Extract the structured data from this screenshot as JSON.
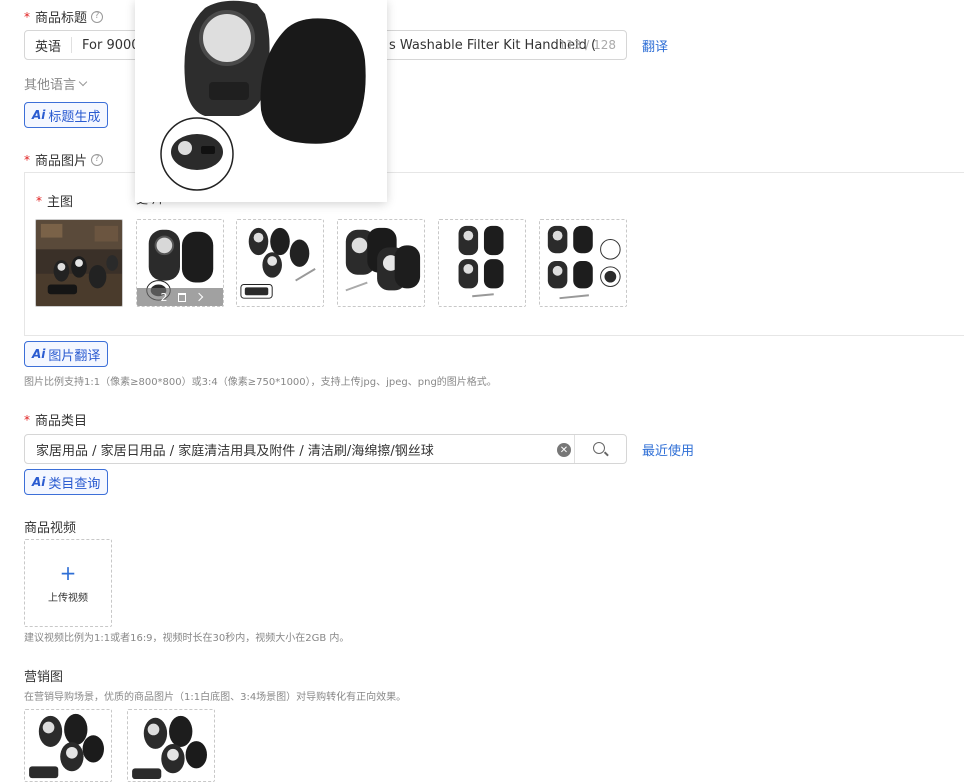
{
  "title_field": {
    "label": "商品标题",
    "language": "英语",
    "value_left": "For  9000 S",
    "value_right": "s Washable Filter Kit Handheld (",
    "counter": "113 / 128",
    "translate_link": "翻译"
  },
  "other_languages": "其他语言",
  "ai_title_button": "标题生成",
  "images_field": {
    "label": "商品图片",
    "main_label": "主图",
    "overlap_text": "更‧片",
    "hover_controls": "2",
    "thumbnails": [
      "workbench-photo",
      "filter-pair",
      "filter-kit",
      "filter-pair-brush",
      "four-filters",
      "filter-set"
    ]
  },
  "ai_image_translate_button": "图片翻译",
  "images_hint": "图片比例支持1:1（像素≥800*800）或3:4（像素≥750*1000），支持上传jpg、jpeg、png的图片格式。",
  "category_field": {
    "label": "商品类目",
    "value": "家居用品 / 家居日用品 / 家庭清洁用具及附件 / 清洁刷/海绵擦/钢丝球",
    "recent_link": "最近使用"
  },
  "ai_category_button": "类目查询",
  "video_field": {
    "label": "商品视频",
    "upload_label": "上传视频",
    "hint": "建议视频比例为1:1或者16:9，视频时长在30秒内，视频大小在2GB 内。"
  },
  "marketing_field": {
    "label": "营销图",
    "hint": "在营销导购场景，优质的商品图片（1:1白底图、3:4场景图）对导购转化有正向效果。"
  },
  "ai_mark": "Ai",
  "required_mark": "*",
  "help_glyph": "?",
  "plus_glyph": "+",
  "search_icon": "search-icon",
  "clear_icon": "clear-icon",
  "accent_color": "#2f6fd6",
  "required_color": "#e02020"
}
